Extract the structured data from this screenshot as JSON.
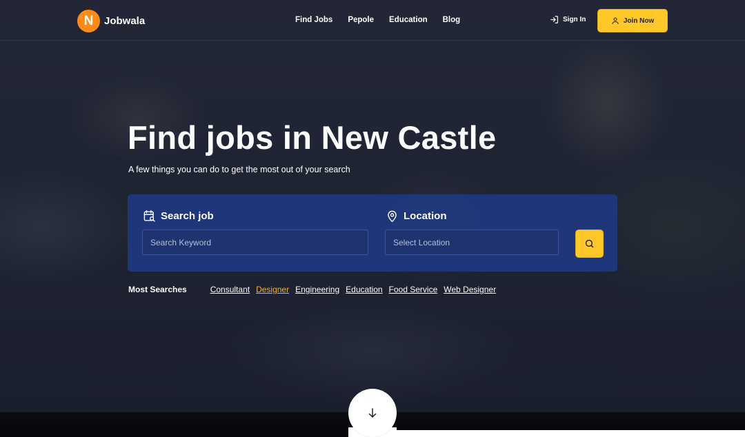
{
  "brand": {
    "logo_letter": "N",
    "name": "Jobwala",
    "accent": "#ff8a1a"
  },
  "nav": {
    "links": [
      "Find Jobs",
      "Pepole",
      "Education",
      "Blog"
    ],
    "signin_label": "Sign In",
    "join_label": "Join Now",
    "join_color": "#ffc727"
  },
  "hero": {
    "title": "Find jobs in New Castle",
    "subtitle": "A few things you can do to get the most out of your search"
  },
  "search": {
    "job_label": "Search job",
    "job_placeholder": "Search Keyword",
    "job_value": "",
    "location_label": "Location",
    "location_placeholder": "Select Location",
    "location_value": "",
    "card_color": "#203880"
  },
  "most_searches": {
    "label": "Most Searches",
    "items": [
      "Consultant",
      "Designer",
      "Engineering",
      "Education",
      "Food Service",
      "Web Designer"
    ],
    "active_color": "#f0b437"
  },
  "icons": {
    "signin": "sign-in-icon",
    "join": "user-icon",
    "job": "calendar-search-icon",
    "location": "map-pin-icon",
    "search": "search-icon",
    "scroll": "arrow-down-icon"
  }
}
